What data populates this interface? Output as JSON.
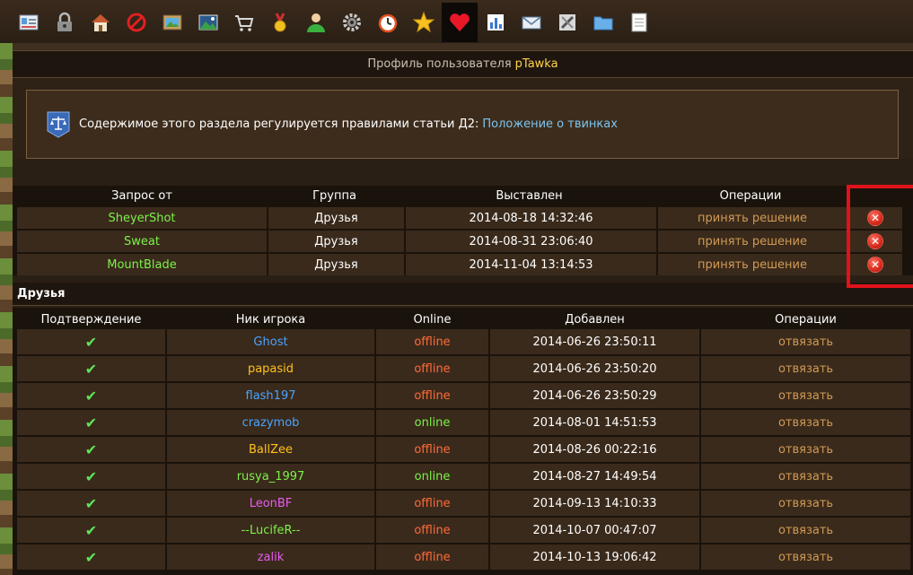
{
  "toolbar": {
    "icons": [
      "id-card-icon",
      "lock-icon",
      "home-icon",
      "forbidden-icon",
      "picture-icon",
      "landscape-icon",
      "cart-icon",
      "medal-icon",
      "user-icon",
      "gear-icon",
      "alarm-clock-icon",
      "star-icon",
      "heart-icon",
      "chart-icon",
      "mail-icon",
      "tools-icon",
      "folder-icon",
      "notepad-icon"
    ],
    "active_index": 12
  },
  "profile": {
    "title_prefix": "Профиль пользователя",
    "username": "pTawka"
  },
  "rules": {
    "text": "Содержимое этого раздела регулируется правилами статьи Д2:",
    "link": "Положение о твинках"
  },
  "requests": {
    "headers": [
      "Запрос от",
      "Группа",
      "Выставлен",
      "Операции"
    ],
    "rows": [
      {
        "from": "SheyerShot",
        "group": "Друзья",
        "date": "2014-08-18 14:32:46",
        "action": "принять решение"
      },
      {
        "from": "Sweat",
        "group": "Друзья",
        "date": "2014-08-31 23:06:40",
        "action": "принять решение"
      },
      {
        "from": "MountBlade",
        "group": "Друзья",
        "date": "2014-11-04 13:14:53",
        "action": "принять решение"
      }
    ]
  },
  "friends": {
    "title": "Друзья",
    "headers": [
      "Подтверждение",
      "Ник игрока",
      "Online",
      "Добавлен",
      "Операции"
    ],
    "rows": [
      {
        "nick": "Ghost",
        "color": "#4aa3ff",
        "status": "offline",
        "date": "2014-06-26 23:50:11",
        "action": "отвязать"
      },
      {
        "nick": "papasid",
        "color": "#ffc21a",
        "status": "offline",
        "date": "2014-06-26 23:50:20",
        "action": "отвязать"
      },
      {
        "nick": "flash197",
        "color": "#4aa3ff",
        "status": "offline",
        "date": "2014-06-26 23:50:29",
        "action": "отвязать"
      },
      {
        "nick": "crazymob",
        "color": "#4aa3ff",
        "status": "online",
        "date": "2014-08-01 14:51:53",
        "action": "отвязать"
      },
      {
        "nick": "BallZee",
        "color": "#ffc21a",
        "status": "offline",
        "date": "2014-08-26 00:22:16",
        "action": "отвязать"
      },
      {
        "nick": "rusya_1997",
        "color": "#7cf24a",
        "status": "online",
        "date": "2014-08-27 14:49:54",
        "action": "отвязать"
      },
      {
        "nick": "LeonBF",
        "color": "#e85cf0",
        "status": "offline",
        "date": "2014-09-13 14:10:33",
        "action": "отвязать"
      },
      {
        "nick": "--LucifeR--",
        "color": "#7cf24a",
        "status": "offline",
        "date": "2014-10-07 00:47:07",
        "action": "отвязать"
      },
      {
        "nick": "zalik",
        "color": "#e85cf0",
        "status": "offline",
        "date": "2014-10-13 19:06:42",
        "action": "отвязать"
      }
    ]
  }
}
